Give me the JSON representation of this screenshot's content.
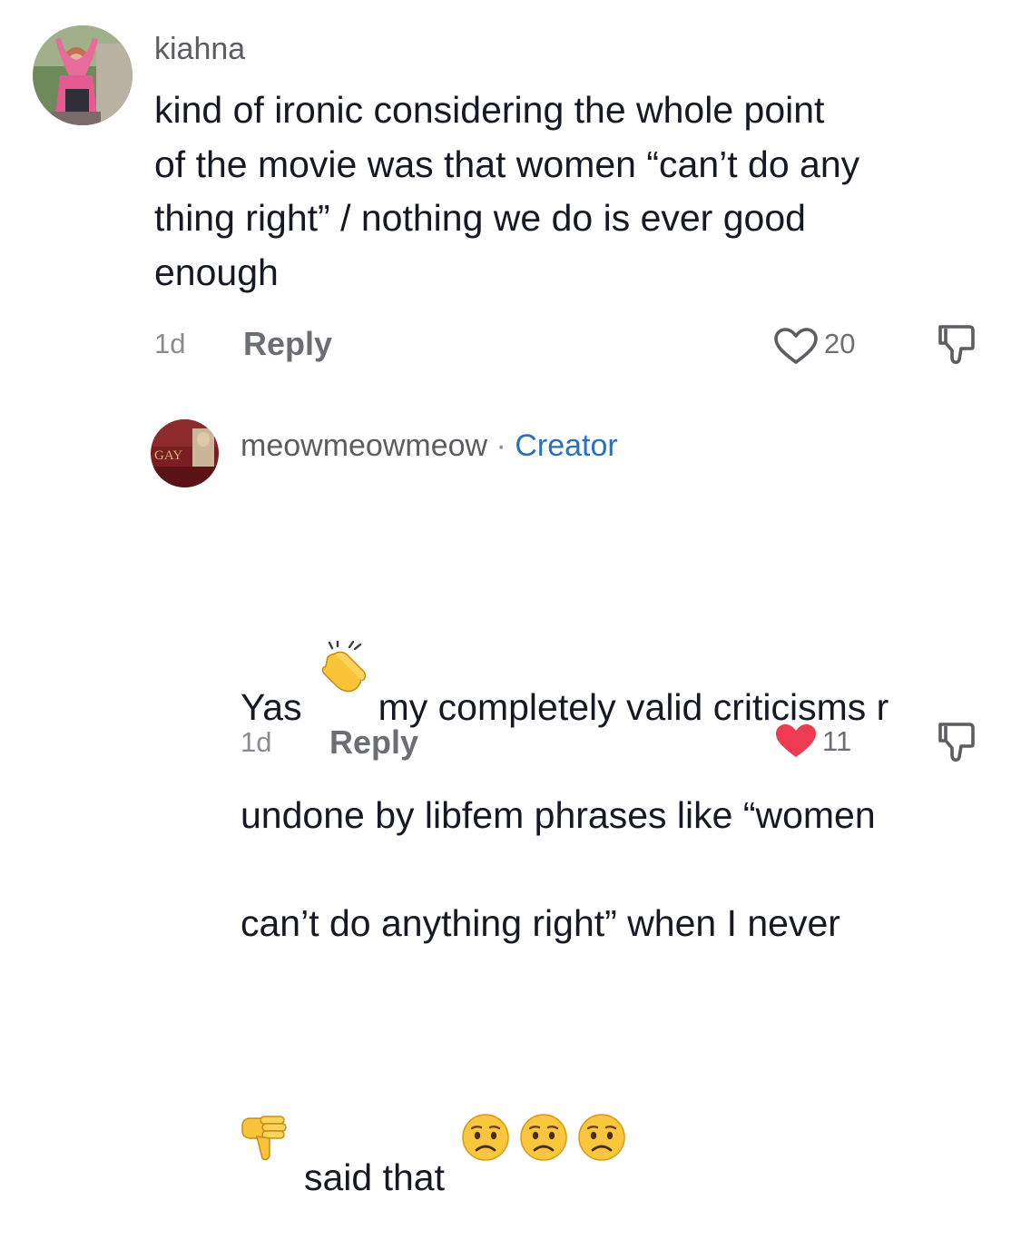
{
  "comments": [
    {
      "username": "kiahna",
      "text_lines": [
        "kind of ironic considering the whole point",
        "of the movie was that women “can’t do any",
        "thing right” / nothing we do is ever good",
        "enough"
      ],
      "time": "1d",
      "reply_label": "Reply",
      "like_count": "20",
      "liked": false
    },
    {
      "username": "meowmeowmeow",
      "separator": "·",
      "badge": "Creator",
      "avatar_text": "GAY",
      "line1_a": "Yas",
      "line1_b": "my completely valid criticisms r",
      "line2": "undone by libfem phrases like “women",
      "line3": "can’t do anything right” when I never",
      "line4_text": "said that",
      "emojis": [
        "clapping-hands-emoji",
        "thumbs-down-emoji",
        "worried-face-emoji",
        "worried-face-emoji",
        "worried-face-emoji"
      ],
      "time": "1d",
      "reply_label": "Reply",
      "like_count": "11",
      "liked": true
    }
  ],
  "colors": {
    "text": "#161823",
    "muted": "#8a8b91",
    "creator": "#2b6fbf",
    "liked_heart": "#fe2c55"
  }
}
